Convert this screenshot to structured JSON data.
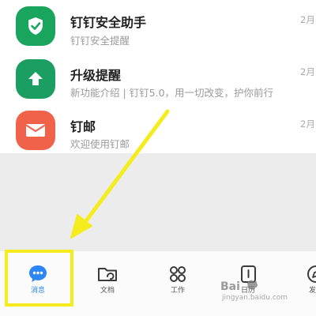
{
  "messages": [
    {
      "title": "钉钉安全助手",
      "subtitle": "钉钉安全提醒",
      "date": "2月",
      "icon": "shield-check-icon",
      "icon_color": "#1aa55e"
    },
    {
      "title": "升级提醒",
      "subtitle": "新功能介绍 | 钉钉5.0，用一切改变，护你前行",
      "date": "2月",
      "icon": "upload-arrow-icon",
      "icon_color": "#1a9e62"
    },
    {
      "title": "钉邮",
      "subtitle": "欢迎使用钉邮",
      "date": "2月",
      "icon": "mail-icon",
      "icon_color": "#f0634a"
    }
  ],
  "tabbar": {
    "tabs": [
      {
        "label": "消息",
        "icon": "chat-bubble-icon",
        "active": true
      },
      {
        "label": "文档",
        "icon": "folder-icon",
        "active": false
      },
      {
        "label": "工作",
        "icon": "grid-apps-icon",
        "active": false
      },
      {
        "label": "日历",
        "icon": "calendar-icon",
        "active": false
      },
      {
        "label": "发现",
        "icon": "compass-icon",
        "active": false
      }
    ]
  },
  "annotation": {
    "highlight_color": "#f4ec1c",
    "arrow_color": "#f4ec1c"
  },
  "watermark": {
    "text": "jingyan.baidu.com",
    "logo": "Bai"
  },
  "colors": {
    "accent": "#2c86f6",
    "background": "#ececec"
  }
}
